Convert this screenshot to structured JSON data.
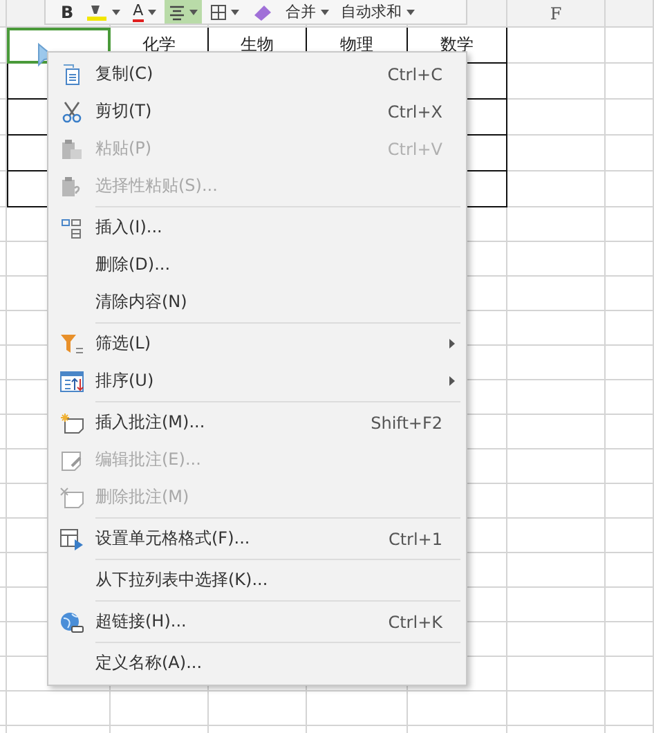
{
  "sheet": {
    "column_header": "F",
    "first_row": [
      {
        "selected": true
      },
      {
        "text": "化学",
        "selected": false
      },
      {
        "text": "生物",
        "selected": false
      },
      {
        "text": "物理",
        "selected": false
      },
      {
        "text": "数学",
        "selected": false
      }
    ]
  },
  "mini_toolbar": {
    "buttons": [
      {
        "kind": "bold",
        "label": "B",
        "selected": false
      },
      {
        "kind": "fill",
        "selected": false
      },
      {
        "kind": "font-color",
        "label": "A",
        "selected": false
      },
      {
        "kind": "align",
        "selected": true
      },
      {
        "kind": "border",
        "selected": false
      },
      {
        "kind": "eraser",
        "selected": false
      },
      {
        "kind": "dropdown",
        "label": "合并",
        "selected": false
      },
      {
        "kind": "dropdown",
        "label": "自动求和",
        "selected": false
      }
    ]
  },
  "context_menu": {
    "groups": [
      [
        {
          "label": "复制(C)",
          "shortcut": "Ctrl+C",
          "disabled": false,
          "submenu": false
        },
        {
          "label": "剪切(T)",
          "shortcut": "Ctrl+X",
          "disabled": false,
          "submenu": false
        },
        {
          "label": "粘贴(P)",
          "shortcut": "Ctrl+V",
          "disabled": true,
          "submenu": false
        },
        {
          "label": "选择性粘贴(S)...",
          "disabled": true,
          "submenu": false
        }
      ],
      [
        {
          "label": "插入(I)...",
          "disabled": false,
          "submenu": false
        },
        {
          "label": "删除(D)...",
          "disabled": false,
          "submenu": false
        },
        {
          "label": "清除内容(N)",
          "disabled": false,
          "submenu": false
        }
      ],
      [
        {
          "label": "筛选(L)",
          "disabled": false,
          "submenu": true
        },
        {
          "label": "排序(U)",
          "disabled": false,
          "submenu": true
        }
      ],
      [
        {
          "label": "插入批注(M)...",
          "shortcut": "Shift+F2",
          "disabled": false,
          "submenu": false
        },
        {
          "label": "编辑批注(E)...",
          "disabled": true,
          "submenu": false
        },
        {
          "label": "删除批注(M)",
          "disabled": true,
          "submenu": false
        }
      ],
      [
        {
          "label": "设置单元格格式(F)...",
          "shortcut": "Ctrl+1",
          "disabled": false,
          "submenu": false
        }
      ],
      [
        {
          "label": "从下拉列表中选择(K)...",
          "disabled": false,
          "submenu": false
        }
      ],
      [
        {
          "label": "超链接(H)...",
          "shortcut": "Ctrl+K",
          "disabled": false,
          "submenu": false
        }
      ],
      [
        {
          "label": "定义名称(A)...",
          "disabled": false,
          "submenu": false
        }
      ]
    ]
  }
}
